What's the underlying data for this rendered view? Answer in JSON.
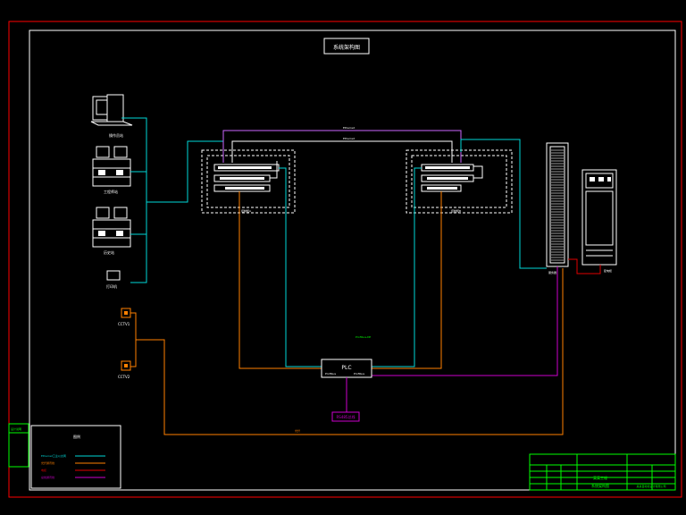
{
  "drawing": {
    "title": "系统架构图",
    "colors": {
      "background": "#000000",
      "border": "#ff0000",
      "frame": "#ffffff",
      "ethernet": "#00d7d7",
      "fiber": "#ff8000",
      "cable": "#e00000",
      "bus": "#cc00cc",
      "green": "#00ff00",
      "label": "#ffffff"
    }
  },
  "left_devices": {
    "computer_label": "操作员站",
    "workstation_1_label": "工程师站",
    "workstation_2_label": "历史站",
    "printer_label": "打印机",
    "camera_1_label": "CCTV1",
    "camera_2_label": "CCTV2"
  },
  "racks": {
    "left_cabinet_label": "控制柜A",
    "right_cabinet_label": "控制柜B",
    "server_label": "服务器",
    "panel_label": "配电柜"
  },
  "center": {
    "plc_label": "PLC",
    "plc_port_left": "Profibus",
    "plc_port_right": "Profibus",
    "bus_box_label": "RS485总线",
    "net_label_top": "Ethernet",
    "net_label_mid": "Ethernet",
    "dp_label": "Profibus-DP",
    "fiber_label": "光纤"
  },
  "legend": {
    "title": "图例",
    "items": [
      {
        "label": "Ethernet工业以太网",
        "color_key": "ethernet"
      },
      {
        "label": "光纤通讯线",
        "color_key": "fiber"
      },
      {
        "label": "电缆",
        "color_key": "cable"
      },
      {
        "label": "总线通讯线",
        "color_key": "bus"
      }
    ]
  },
  "left_box": {
    "label": "设计说明"
  },
  "title_block": {
    "project": "某某工程",
    "drawing_name": "系统架构图",
    "company": "某某自动化设计有限公司"
  }
}
